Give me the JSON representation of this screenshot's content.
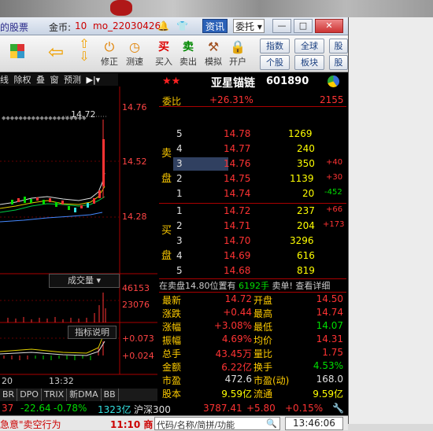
{
  "titlebar": {
    "app_name": "的股票",
    "coin_label": "金币:",
    "coin_value": "10",
    "user": "mo_220304268",
    "news_label": "资讯",
    "trust_label": "委托 ▾",
    "min_label": "—",
    "max_label": "□",
    "close_label": "✕"
  },
  "toolbar": {
    "items": [
      {
        "label": "修正",
        "icon": "reset-icon"
      },
      {
        "label": "测速",
        "icon": "speed-icon"
      },
      {
        "label": "买入",
        "icon": "buy-icon",
        "glyph": "买"
      },
      {
        "label": "卖出",
        "icon": "sell-icon",
        "glyph": "卖"
      },
      {
        "label": "模拟",
        "icon": "gavel-icon"
      },
      {
        "label": "开户",
        "icon": "lock-icon"
      }
    ],
    "small_buttons": [
      "指数",
      "全球",
      "股",
      "个股",
      "板块",
      "股"
    ]
  },
  "chart": {
    "indicators": [
      "线",
      "除权",
      "叠",
      "窗",
      "预测"
    ],
    "price_labels": [
      "14.76",
      "14.52",
      "14.28"
    ],
    "current_price_tag": "14.72",
    "volume_tab": "成交量",
    "volume_labels": [
      "46153",
      "23076"
    ],
    "help_label": "指标说明",
    "macd_labels": [
      "+0.073",
      "+0.024"
    ],
    "time_labels": [
      "20",
      "13:32"
    ],
    "tabs": [
      "BR",
      "DPO",
      "TRIX",
      "新DMA",
      "BB"
    ]
  },
  "stock": {
    "stars": "★★",
    "name": "亚星锚链",
    "code": "601890",
    "weibi_label": "委比",
    "weibi_value": "+26.31%",
    "weicha_value": "2155",
    "sell_side_label": [
      "卖",
      "盘"
    ],
    "buy_side_label": [
      "买",
      "盘"
    ],
    "sells": [
      {
        "level": "5",
        "price": "14.78",
        "vol": "1269",
        "chg": ""
      },
      {
        "level": "4",
        "price": "14.77",
        "vol": "240",
        "chg": ""
      },
      {
        "level": "3",
        "price": "14.76",
        "vol": "350",
        "chg": "+40"
      },
      {
        "level": "2",
        "price": "14.75",
        "vol": "1139",
        "chg": "+30"
      },
      {
        "level": "1",
        "price": "14.74",
        "vol": "20",
        "chg": "-452"
      }
    ],
    "buys": [
      {
        "level": "1",
        "price": "14.72",
        "vol": "237",
        "chg": "+66"
      },
      {
        "level": "2",
        "price": "14.71",
        "vol": "204",
        "chg": "+173"
      },
      {
        "level": "3",
        "price": "14.70",
        "vol": "3296",
        "chg": ""
      },
      {
        "level": "4",
        "price": "14.69",
        "vol": "616",
        "chg": ""
      },
      {
        "level": "5",
        "price": "14.68",
        "vol": "819",
        "chg": ""
      }
    ],
    "trade_notice": "在卖盘14.80位置有",
    "trade_notice_vol": "6192手",
    "trade_notice_tail": "卖单! 查看详细",
    "quote": [
      {
        "l1": "最新",
        "v1": "14.72",
        "l2": "开盘",
        "v2": "14.50"
      },
      {
        "l1": "涨跌",
        "v1": "+0.44",
        "l2": "最高",
        "v2": "14.74"
      },
      {
        "l1": "涨幅",
        "v1": "+3.08%",
        "l2": "最低",
        "v2": "14.07"
      },
      {
        "l1": "振幅",
        "v1": "4.69%",
        "l2": "均价",
        "v2": "14.31"
      },
      {
        "l1": "总手",
        "v1": "43.45万",
        "l2": "量比",
        "v2": "1.75"
      },
      {
        "l1": "金额",
        "v1": "6.22亿",
        "l2": "换手",
        "v2": "4.53%"
      },
      {
        "l1": "市盈",
        "v1": "472.6",
        "l2": "市盈(动)",
        "v2": "168.0"
      },
      {
        "l1": "股本",
        "v1": "9.59亿",
        "l2": "流通",
        "v2": "9.59亿"
      }
    ]
  },
  "indexbar": {
    "v1": "37",
    "v2": "-22.64",
    "v3": "-0.78%",
    "v4": "1323亿",
    "idx_name": "沪深300",
    "idx_value": "3787.41",
    "idx_change": "+5.80",
    "idx_pct": "+0.15%"
  },
  "statusbar": {
    "news": "急意\"卖空行为",
    "time_news": "11:10 商",
    "search_placeholder": "代码/名称/简拼/功能",
    "clock": "13:46:06"
  },
  "colors": {
    "up": "#ff3333",
    "down": "#00dd00",
    "label": "#ffcc00",
    "accent": "#2b61b7"
  }
}
